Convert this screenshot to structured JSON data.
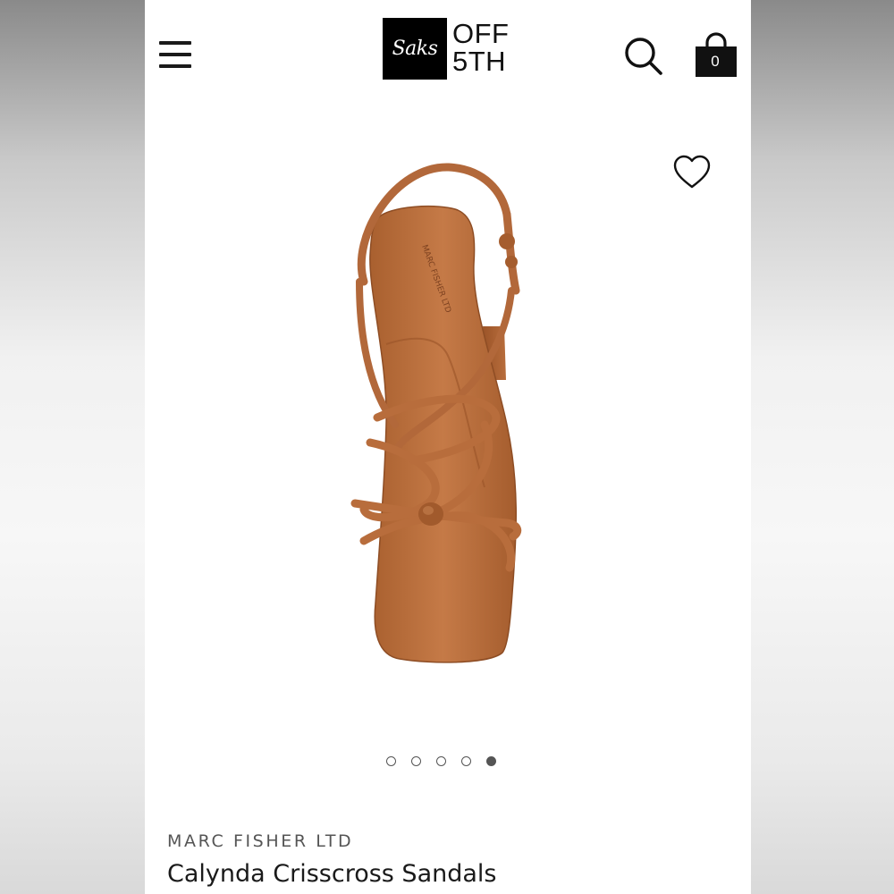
{
  "header": {
    "logo": {
      "box_text": "Saks",
      "line1": "OFF",
      "line2": "5TH"
    },
    "bag_count": "0",
    "icons": [
      "menu-icon",
      "search-icon",
      "shopping-bag-icon",
      "heart-icon"
    ]
  },
  "gallery": {
    "image_count": 5,
    "active_index": 4
  },
  "product": {
    "brand": "MARC FISHER LTD",
    "name": "Calynda Crisscross Sandals",
    "color": "#b86d3c"
  }
}
